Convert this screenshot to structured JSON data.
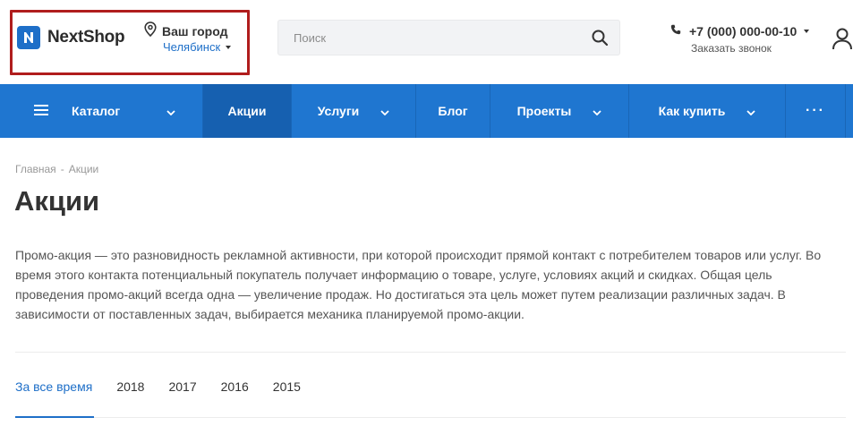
{
  "header": {
    "logo_text": "NextShop",
    "city_label": "Ваш город",
    "city_name": "Челябинск",
    "search_placeholder": "Поиск",
    "phone": "+7 (000) 000-00-10",
    "callback": "Заказать звонок"
  },
  "nav": {
    "items": [
      {
        "label": "Каталог"
      },
      {
        "label": "Акции"
      },
      {
        "label": "Услуги"
      },
      {
        "label": "Блог"
      },
      {
        "label": "Проекты"
      },
      {
        "label": "Как купить"
      },
      {
        "label": "···"
      }
    ]
  },
  "breadcrumb": {
    "home": "Главная",
    "separator": "-",
    "current": "Акции"
  },
  "page": {
    "title": "Акции",
    "description": "Промо-акция — это разновидность рекламной активности, при которой происходит прямой контакт с потребителем товаров или услуг. Во время этого контакта потенциальный покупатель получает информацию о товаре, услуге, условиях акций и скидках. Общая цель проведения промо-акций всегда одна — увеличение продаж. Но достигаться эта цель может путем реализации различных задач. В зависимости от поставленных задач, выбирается механика планируемой промо-акции."
  },
  "tabs": [
    {
      "label": "За все время",
      "active": true
    },
    {
      "label": "2018"
    },
    {
      "label": "2017"
    },
    {
      "label": "2016"
    },
    {
      "label": "2015"
    }
  ],
  "colors": {
    "accent": "#1e6fc8",
    "nav_bg": "#1f76d0",
    "nav_active": "#1660b0",
    "highlight_border": "#b01d1d"
  },
  "icons": {
    "logo": "n-logo-icon",
    "city": "map-pin-icon",
    "search": "search-icon",
    "phone": "phone-icon",
    "user": "user-icon",
    "menu": "hamburger-icon",
    "dropdown": "chevron-down-icon"
  }
}
